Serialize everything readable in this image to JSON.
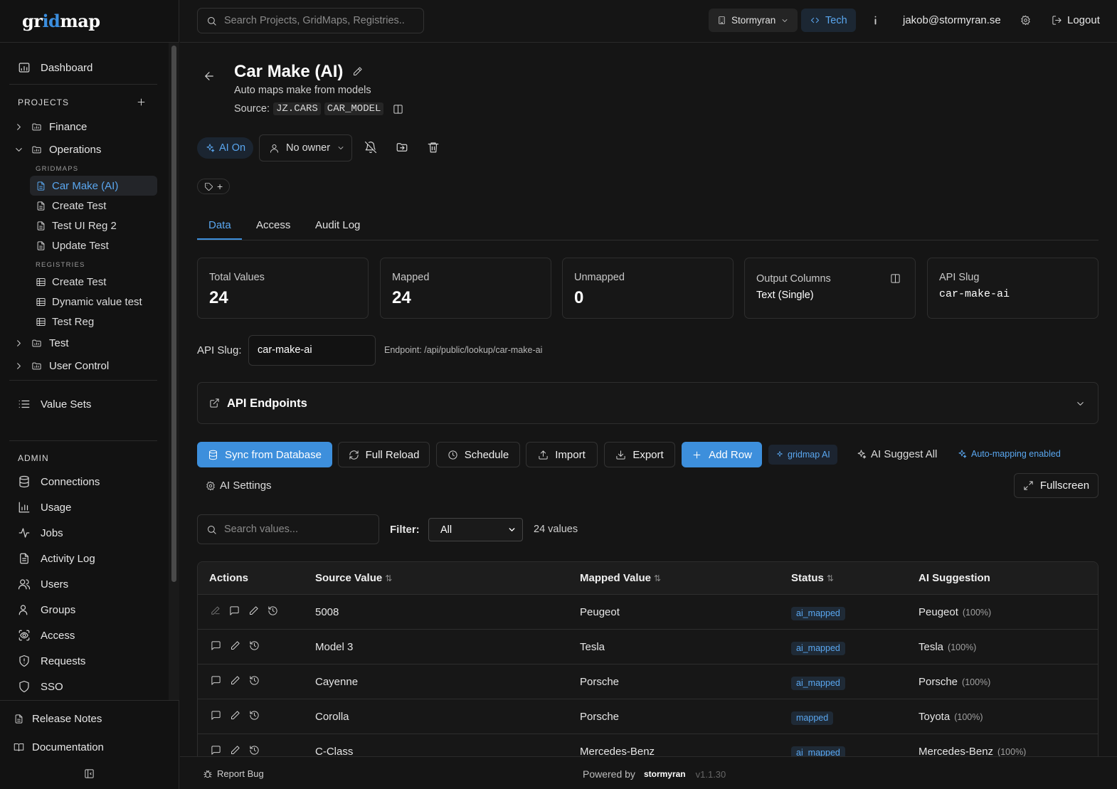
{
  "app": {
    "logo_pre": "gr",
    "logo_hl": "id",
    "logo_post": "map"
  },
  "topbar": {
    "search_placeholder": "Search Projects, GridMaps, Registries..",
    "org": "Stormyran",
    "mode": "Tech",
    "user_email": "jakob@stormyran.se",
    "logout": "Logout"
  },
  "sidebar": {
    "dashboard": "Dashboard",
    "projects_label": "PROJECTS",
    "projects": [
      {
        "name": "Finance",
        "expanded": false
      },
      {
        "name": "Operations",
        "expanded": true
      },
      {
        "name": "Test",
        "expanded": false
      },
      {
        "name": "User Control",
        "expanded": false
      }
    ],
    "gridmaps_label": "GRIDMAPS",
    "gridmaps": [
      "Car Make (AI)",
      "Create Test",
      "Test UI Reg 2",
      "Update Test"
    ],
    "registries_label": "REGISTRIES",
    "registries": [
      "Create Test",
      "Dynamic value test",
      "Test Reg"
    ],
    "value_sets": "Value Sets",
    "admin_label": "ADMIN",
    "admin": [
      "Connections",
      "Usage",
      "Jobs",
      "Activity Log",
      "Users",
      "Groups",
      "Access",
      "Requests",
      "SSO"
    ],
    "release_notes": "Release Notes",
    "documentation": "Documentation"
  },
  "header": {
    "title": "Car Make (AI)",
    "description": "Auto maps make from models",
    "source_label": "Source:",
    "source_table": "JZ.CARS",
    "source_column": "CAR_MODEL",
    "ai_toggle": "AI On",
    "owner": "No owner"
  },
  "tabs": [
    "Data",
    "Access",
    "Audit Log"
  ],
  "stats": {
    "total_label": "Total Values",
    "total": "24",
    "mapped_label": "Mapped",
    "mapped": "24",
    "unmapped_label": "Unmapped",
    "unmapped": "0",
    "output_label": "Output Columns",
    "output": "Text (Single)",
    "slug_label": "API Slug",
    "slug": "car-make-ai"
  },
  "api": {
    "slug_field_label": "API Slug:",
    "slug_value": "car-make-ai",
    "endpoint": "Endpoint: /api/public/lookup/car-make-ai",
    "endpoints_title": "API Endpoints"
  },
  "toolbar": {
    "sync": "Sync from Database",
    "full_reload": "Full Reload",
    "schedule": "Schedule",
    "import": "Import",
    "export": "Export",
    "add_row": "Add Row",
    "gridmap_ai": "gridmap AI",
    "suggest_all": "AI Suggest All",
    "auto_mapping": "Auto-mapping enabled",
    "ai_settings": "AI Settings",
    "fullscreen": "Fullscreen"
  },
  "filter": {
    "search_placeholder": "Search values...",
    "label": "Filter:",
    "selected": "All",
    "count": "24 values"
  },
  "table": {
    "headers": {
      "actions": "Actions",
      "source": "Source Value",
      "mapped": "Mapped Value",
      "status": "Status",
      "ai": "AI Suggestion"
    },
    "rows": [
      {
        "source": "5008",
        "mapped": "Peugeot",
        "status": "ai_mapped",
        "ai": "Peugeot",
        "conf": "(100%)"
      },
      {
        "source": "Model 3",
        "mapped": "Tesla",
        "status": "ai_mapped",
        "ai": "Tesla",
        "conf": "(100%)"
      },
      {
        "source": "Cayenne",
        "mapped": "Porsche",
        "status": "ai_mapped",
        "ai": "Porsche",
        "conf": "(100%)"
      },
      {
        "source": "Corolla",
        "mapped": "Porsche",
        "status": "mapped",
        "ai": "Toyota",
        "conf": "(100%)"
      },
      {
        "source": "C-Class",
        "mapped": "Mercedes-Benz",
        "status": "ai_mapped",
        "ai": "Mercedes-Benz",
        "conf": "(100%)"
      }
    ]
  },
  "footer": {
    "report_bug": "Report Bug",
    "powered_by": "Powered by",
    "brand": "stormyran",
    "version": "v1.1.30"
  },
  "colors": {
    "accent": "#3d8fdc",
    "background": "#151515",
    "sidebar": "#121212",
    "badge_text": "#5aa7f0"
  }
}
